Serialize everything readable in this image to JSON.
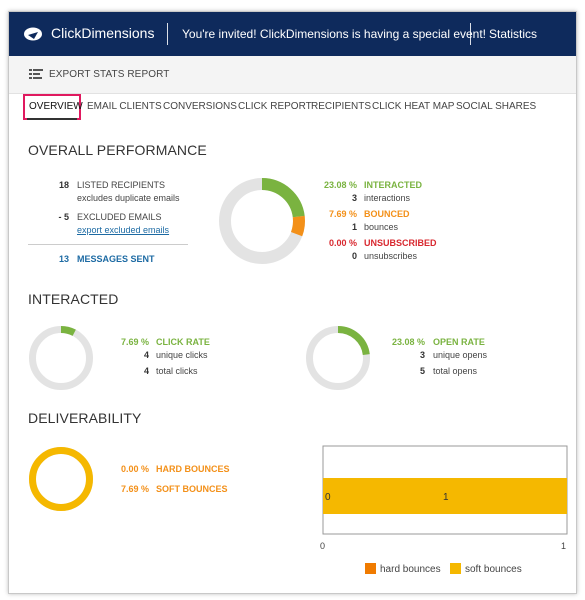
{
  "app": {
    "brand": "ClickDimensions",
    "banner": "You're invited! ClickDimensions is having a special event!",
    "nav_right": "Statistics"
  },
  "toolbar": {
    "export_label": "EXPORT STATS REPORT"
  },
  "tabs": [
    {
      "label": "OVERVIEW",
      "active": true
    },
    {
      "label": "EMAIL CLIENTS",
      "active": false
    },
    {
      "label": "CONVERSIONS",
      "active": false
    },
    {
      "label": "CLICK REPORT",
      "active": false
    },
    {
      "label": "RECIPIENTS",
      "active": false
    },
    {
      "label": "CLICK HEAT MAP",
      "active": false
    },
    {
      "label": "SOCIAL SHARES",
      "active": false
    }
  ],
  "overall": {
    "title": "OVERALL PERFORMANCE",
    "listed": {
      "value": "18",
      "label": "LISTED RECIPIENTS",
      "sub": "excludes duplicate emails"
    },
    "excluded": {
      "value": "- 5",
      "label": "EXCLUDED EMAILS",
      "link": "export excluded emails"
    },
    "sent": {
      "value": "13",
      "label": "MESSAGES SENT"
    },
    "interacted": {
      "pct": "23.08 %",
      "label": "INTERACTED",
      "count": "3",
      "unit": "interactions",
      "fraction": 0.2308
    },
    "bounced": {
      "pct": "7.69 %",
      "label": "BOUNCED",
      "count": "1",
      "unit": "bounces",
      "fraction": 0.0769
    },
    "unsubscribed": {
      "pct": "0.00 %",
      "label": "UNSUBSCRIBED",
      "count": "0",
      "unit": "unsubscribes",
      "fraction": 0
    }
  },
  "interacted": {
    "title": "INTERACTED",
    "click": {
      "pct": "7.69 %",
      "label": "CLICK RATE",
      "unique": "4",
      "unique_label": "unique clicks",
      "total": "4",
      "total_label": "total clicks",
      "fraction": 0.0769
    },
    "open": {
      "pct": "23.08 %",
      "label": "OPEN RATE",
      "unique": "3",
      "unique_label": "unique opens",
      "total": "5",
      "total_label": "total opens",
      "fraction": 0.2308
    }
  },
  "deliverability": {
    "title": "DELIVERABILITY",
    "hard": {
      "pct": "0.00 %",
      "label": "HARD BOUNCES"
    },
    "soft": {
      "pct": "7.69 %",
      "label": "SOFT BOUNCES"
    },
    "donut_fraction": 1.0
  },
  "colors": {
    "navy": "#0e2a5c",
    "green": "#7ab340",
    "orange": "#f39019",
    "red": "#d8282f",
    "blue": "#1c6aa3",
    "yellow": "#f5b800",
    "track": "#e3e3e3",
    "hard": "#f07b00",
    "soft": "#f5b800"
  },
  "chart_data": {
    "type": "bar",
    "orientation": "horizontal",
    "categories": [
      ""
    ],
    "series": [
      {
        "name": "hard bounces",
        "values": [
          0
        ]
      },
      {
        "name": "soft bounces",
        "values": [
          1
        ]
      }
    ],
    "stacked": true,
    "xlim": [
      0,
      1
    ],
    "x_ticks": [
      "0",
      "1"
    ],
    "data_labels": [
      "0",
      "1"
    ],
    "legend": "bottom"
  }
}
